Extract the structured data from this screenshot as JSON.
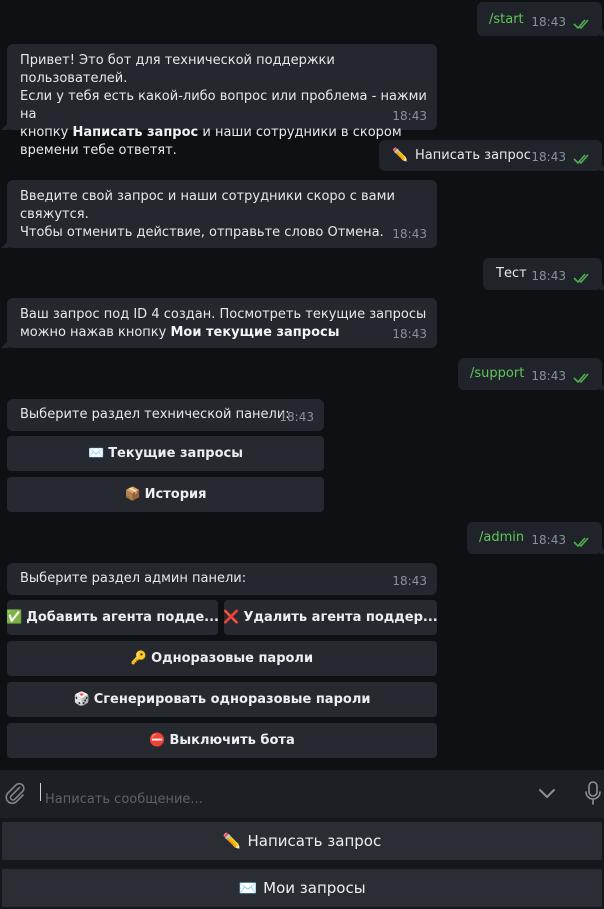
{
  "messages": {
    "start": {
      "text": "/start",
      "time": "18:43"
    },
    "welcome": {
      "line1": "Привет! Это бот для технической поддержки пользователей.",
      "line2": "Если у тебя есть какой-либо вопрос или проблема - нажми на",
      "line3_pre": "кнопку ",
      "line3_bold": "Написать запрос",
      "line3_post": " и наши сотрудники в скором",
      "line4": "времени тебе ответят.",
      "time": "18:43"
    },
    "write_request": {
      "emoji": "✏️",
      "text": "Написать запрос",
      "time": "18:43"
    },
    "enter_request": {
      "line1": "Введите свой запрос и наши сотрудники скоро с вами",
      "line2": "свяжутся.",
      "line3": "Чтобы отменить действие, отправьте слово Отмена.",
      "time": "18:43"
    },
    "test": {
      "text": "Тест",
      "time": "18:43"
    },
    "created": {
      "line1": "Ваш запрос под ID 4 создан. Посмотреть текущие запросы",
      "line2_pre": "можно нажав кнопку ",
      "line2_bold": "Мои текущие запросы",
      "time": "18:43"
    },
    "support": {
      "text": "/support",
      "time": "18:43"
    },
    "support_panel": {
      "text": "Выберите раздел технической панели:",
      "time": "18:43",
      "buttons": [
        {
          "emoji": "✉️",
          "label": "Текущие запросы"
        },
        {
          "emoji": "📦",
          "label": "История"
        }
      ]
    },
    "admin": {
      "text": "/admin",
      "time": "18:43"
    },
    "admin_panel": {
      "text": "Выберите раздел админ панели:",
      "time": "18:43",
      "buttons": [
        {
          "emoji": "✅",
          "label": "Добавить агента подде..."
        },
        {
          "emoji": "❌",
          "label": "Удалить агента поддер..."
        },
        {
          "emoji": "🔑",
          "label": "Одноразовые пароли"
        },
        {
          "emoji": "🎲",
          "label": "Сгенерировать одноразовые пароли"
        },
        {
          "emoji": "⛔",
          "label": "Выключить бота"
        }
      ]
    }
  },
  "input": {
    "placeholder": "Написать сообщение..."
  },
  "reply_keyboard": [
    {
      "emoji": "✏️",
      "label": "Написать запрос"
    },
    {
      "emoji": "✉️",
      "label": "Мои запросы"
    }
  ],
  "colors": {
    "background": "#0e1014",
    "incoming": "#24272d",
    "outgoing": "#20242a",
    "command": "#5ec55a",
    "checks": "#4fae4e"
  }
}
